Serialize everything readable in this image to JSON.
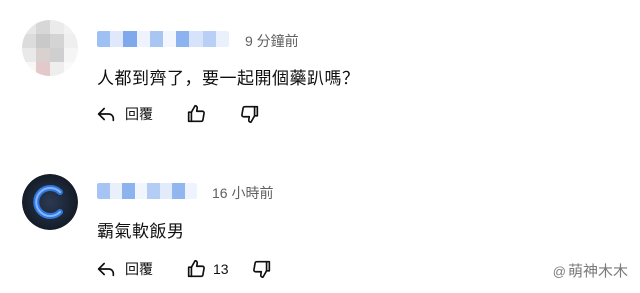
{
  "comments": [
    {
      "author_blurred": true,
      "time": "9 分鐘前",
      "text": "人都到齊了，要一起開個藥趴嗎？",
      "reply_label": "回覆",
      "likes": ""
    },
    {
      "author_blurred": true,
      "time": "16 小時前",
      "text": "霸氣軟飯男",
      "reply_label": "回覆",
      "likes": "13"
    }
  ],
  "icons": [
    "reply-icon",
    "thumbs-up-icon",
    "thumbs-down-icon"
  ],
  "colors": {
    "text": "#0f0f0f",
    "meta": "#606060",
    "name_blur": "#8fb5f0",
    "avatar2_ring": "#2a6fd6",
    "avatar2_bg": "#1c2433"
  },
  "watermark": "萌神木木"
}
